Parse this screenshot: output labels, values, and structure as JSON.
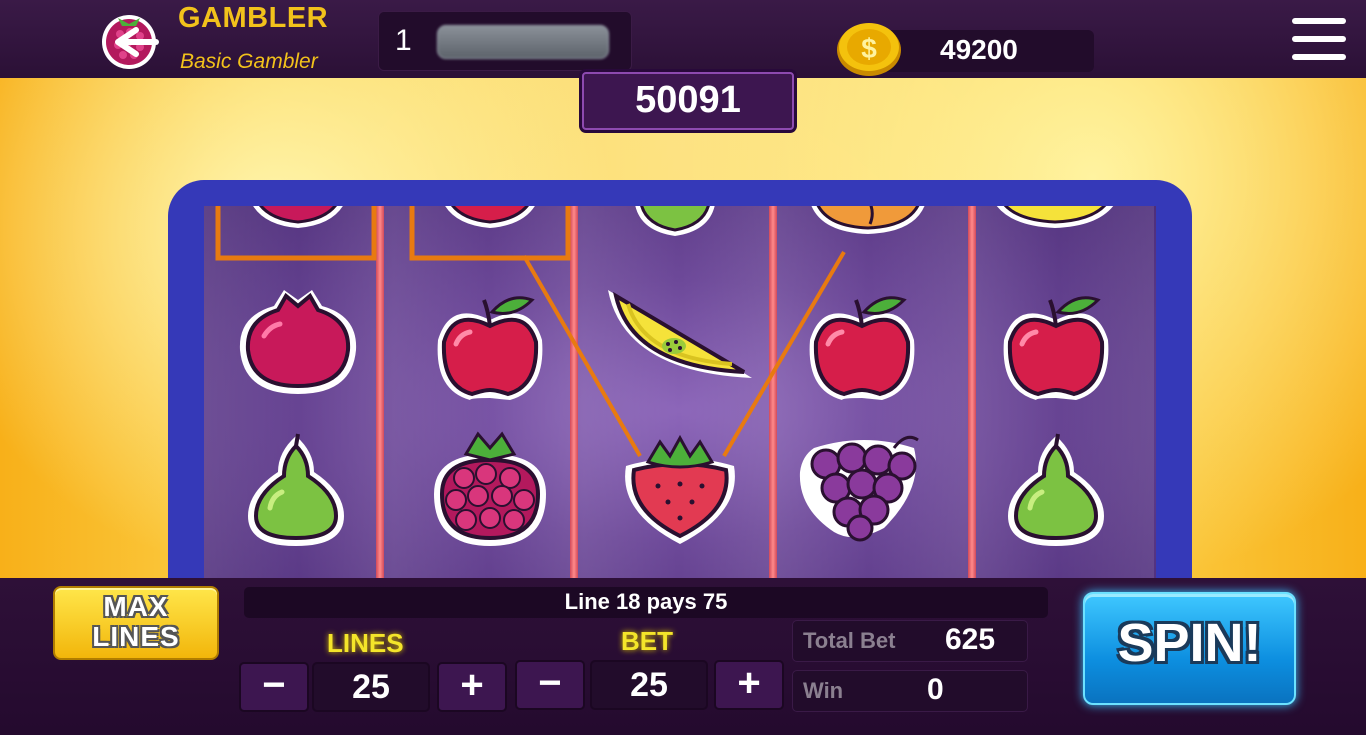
{
  "header": {
    "brand_title": "GAMBLER",
    "brand_subtitle": "Basic Gambler",
    "level": "1",
    "coins": "49200"
  },
  "jackpot": "50091",
  "reels": {
    "columns": [
      [
        "pomegranate",
        "pomegranate",
        "pear"
      ],
      [
        "apple",
        "apple",
        "raspberry"
      ],
      [
        "pear",
        "melon-slice",
        "strawberry"
      ],
      [
        "peach",
        "apple",
        "grapes"
      ],
      [
        "lemon",
        "apple",
        "pear"
      ]
    ],
    "win_line": {
      "number": 18,
      "pays": 75
    }
  },
  "controls": {
    "max_lines_top": "MAX",
    "max_lines_bottom": "LINES",
    "message": "Line 18 pays 75",
    "lines_label": "LINES",
    "lines_value": "25",
    "bet_label": "BET",
    "bet_value": "25",
    "minus": "−",
    "plus": "+",
    "total_bet_label": "Total Bet",
    "total_bet_value": "625",
    "win_label": "Win",
    "win_value": "0",
    "spin_label": "SPIN!"
  },
  "colors": {
    "brand_yellow": "#f2c21b",
    "frame_blue": "#3539b8",
    "spin_blue": "#0d8fe0",
    "win_line_orange": "#e87a10"
  }
}
